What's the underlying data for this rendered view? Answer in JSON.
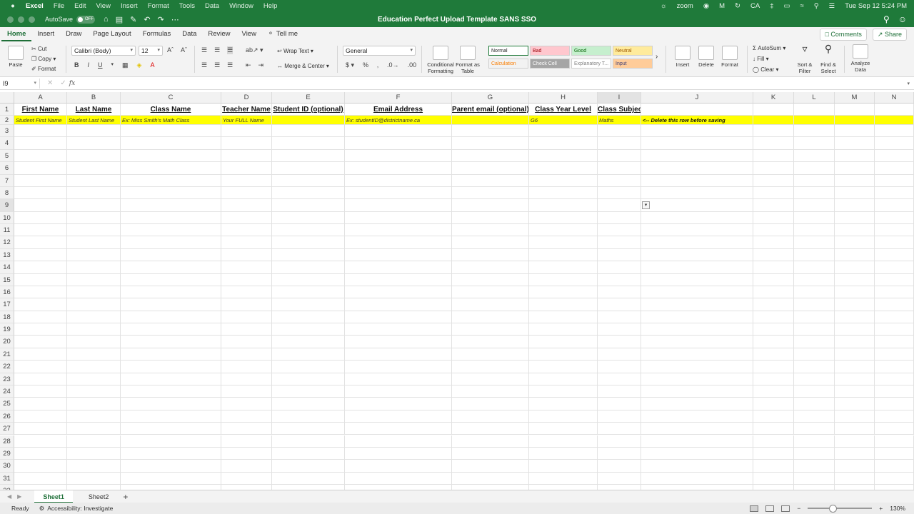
{
  "menubar": {
    "app": "Excel",
    "items": [
      "File",
      "Edit",
      "View",
      "Insert",
      "Format",
      "Tools",
      "Data",
      "Window",
      "Help"
    ],
    "zoom_label": "zoom",
    "ca_label": "CA",
    "clock": "Tue Sep 12  5:24 PM"
  },
  "titlebar": {
    "autosave_label": "AutoSave",
    "autosave_state": "OFF",
    "title": "Education Perfect Upload Template SANS SSO"
  },
  "tabs": {
    "items": [
      "Home",
      "Insert",
      "Draw",
      "Page Layout",
      "Formulas",
      "Data",
      "Review",
      "View"
    ],
    "active": "Home",
    "tell_me": "Tell me",
    "comments": "Comments",
    "share": "Share"
  },
  "ribbon": {
    "paste": "Paste",
    "cut": "Cut",
    "copy": "Copy",
    "format": "Format",
    "font_name": "Calibri (Body)",
    "font_size": "12",
    "wrap_text": "Wrap Text",
    "merge_center": "Merge & Center",
    "number_format": "General",
    "conditional_formatting": "Conditional Formatting",
    "format_as_table": "Format as Table",
    "styles": [
      {
        "label": "Normal",
        "bg": "#ffffff",
        "color": "#222222"
      },
      {
        "label": "Bad",
        "bg": "#ffc7ce",
        "color": "#9c0006"
      },
      {
        "label": "Good",
        "bg": "#c6efce",
        "color": "#006100"
      },
      {
        "label": "Neutral",
        "bg": "#ffeb9c",
        "color": "#9c5700"
      },
      {
        "label": "Calculation",
        "bg": "#f2f2f2",
        "color": "#fa7d00"
      },
      {
        "label": "Check Cell",
        "bg": "#a5a5a5",
        "color": "#ffffff"
      },
      {
        "label": "Explanatory T...",
        "bg": "#ffffff",
        "color": "#7f7f7f"
      },
      {
        "label": "Input",
        "bg": "#ffcc99",
        "color": "#3f3f76"
      }
    ],
    "insert": "Insert",
    "delete": "Delete",
    "format_cells": "Format",
    "autosum": "AutoSum",
    "fill": "Fill",
    "clear": "Clear",
    "sort_filter": "Sort & Filter",
    "find_select": "Find & Select",
    "analyze_data": "Analyze Data"
  },
  "formula_bar": {
    "name_box": "I9",
    "fx": "fx",
    "content": ""
  },
  "columns": [
    {
      "letter": "A",
      "header": "First Name",
      "example": "Student First Name"
    },
    {
      "letter": "B",
      "header": "Last Name",
      "example": "Student Last Name"
    },
    {
      "letter": "C",
      "header": "Class Name",
      "example": "Ex: Miss Smith's Math Class"
    },
    {
      "letter": "D",
      "header": "Teacher Name",
      "example": "Your FULL Name"
    },
    {
      "letter": "E",
      "header": "Student ID (optional)",
      "example": ""
    },
    {
      "letter": "F",
      "header": "Email Address",
      "example": "Ex: studentID@districtname.ca"
    },
    {
      "letter": "G",
      "header": "Parent email (optional)",
      "example": ""
    },
    {
      "letter": "H",
      "header": "Class Year Level",
      "example": "G6"
    },
    {
      "letter": "I",
      "header": "Class Subject",
      "example": "Maths"
    },
    {
      "letter": "J",
      "header": "",
      "example": "<-- Delete this row before saving"
    },
    {
      "letter": "K",
      "header": "",
      "example": ""
    },
    {
      "letter": "L",
      "header": "",
      "example": ""
    },
    {
      "letter": "M",
      "header": "",
      "example": ""
    },
    {
      "letter": "N",
      "header": "",
      "example": ""
    }
  ],
  "row_numbers": [
    "1",
    "2",
    "3",
    "4",
    "5",
    "6",
    "7",
    "8",
    "9",
    "10",
    "11",
    "12",
    "13",
    "14",
    "15",
    "16",
    "17",
    "18",
    "19",
    "20",
    "21",
    "22",
    "23",
    "24",
    "25",
    "26",
    "27",
    "28",
    "29",
    "30",
    "31",
    "32"
  ],
  "sheets": {
    "tabs": [
      "Sheet1",
      "Sheet2"
    ],
    "active": "Sheet1"
  },
  "status": {
    "ready": "Ready",
    "accessibility": "Accessibility: Investigate",
    "zoom": "130%"
  },
  "colors": {
    "accent": "#1f7a3a",
    "highlight_row": "#ffff00"
  }
}
